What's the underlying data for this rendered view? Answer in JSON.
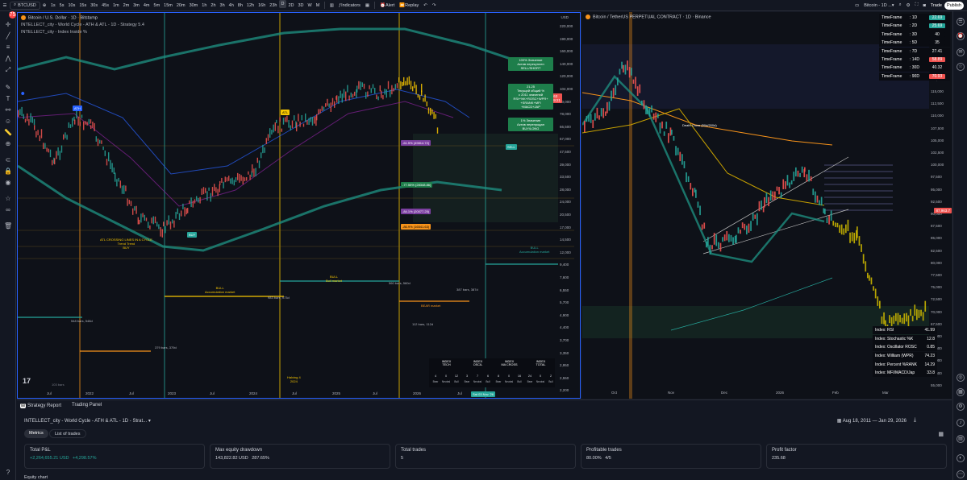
{
  "toolbar": {
    "symbol": "BTCUSD",
    "timeframes": [
      "1s",
      "5s",
      "10s",
      "15s",
      "30s",
      "45s",
      "1m",
      "2m",
      "3m",
      "4m",
      "5m",
      "15m",
      "20m",
      "30m",
      "1h",
      "2h",
      "3h",
      "4h",
      "8h",
      "12h",
      "16h",
      "23h",
      "D",
      "2D",
      "3D",
      "W",
      "M"
    ],
    "selected_timeframe": "D",
    "indicators_label": "Indicators",
    "alert_label": "Alert",
    "replay_label": "Replay",
    "right_symbol": "Bitcoin - 1D ...",
    "trade_label": "Trade",
    "publish_label": "Publish",
    "notif_count": "75"
  },
  "left_pane": {
    "title": "Bitcoin / U.S. Dollar · 1D · Bitstamp",
    "legend1": "INTELLECT_city - World Cycle - ATH & ATL - 1D - Strategy 5.4",
    "legend2": "INTELLECT_city - Index Inside %",
    "currency": "USD",
    "price_axis": [
      "220,000",
      "190,000",
      "160,000",
      "140,000",
      "120,000",
      "104,000",
      "90,000",
      "78,000",
      "66,500",
      "57,000",
      "47,500",
      "39,000",
      "33,500",
      "28,000",
      "24,000",
      "20,500",
      "17,000",
      "14,500",
      "12,000",
      "9,400",
      "7,600",
      "6,550",
      "5,700",
      "4,900",
      "4,400",
      "3,700",
      "3,350",
      "2,950",
      "2,550",
      "2,200"
    ],
    "time_axis": [
      "Jul",
      "2022",
      "Jul",
      "2023",
      "Jul",
      "2024",
      "Jul",
      "2025",
      "Jul",
      "2026",
      "Jul"
    ],
    "current_price": "87,963",
    "current_price_sub": "15:09:21",
    "label_ath": "ATH",
    "label_atl": "ATL",
    "label_bull_acc": "BULL\nAccumulation market",
    "label_bull_mkt": "BULL\nBull market",
    "label_bear_mkt": "BEAR market",
    "label_halving": "Halving 4\n2024",
    "label_bull_acc2": "BULL\nAccumulation market",
    "label_sell_box": "100% Значение\nАктив перекуплен\nSELL/SHORT",
    "label_middle_box": "21.25\nТекущий общий %\nс 2011 значений\nRSI+%K+ROSC+WPR+\n+SRANK+MFI\n+MACD+JAP",
    "label_buy_box": "1% Значение\nАктив перепродан\nBUY/LONG",
    "pct1": "-61.5% (49814.72)",
    "pct2": "-77.55% (28348.86)",
    "pct3": "-84.1% (20077.25)",
    "pct4": "-86.9% (16541.63)",
    "bars1": "103 bars",
    "bars2": "548 bars, 548d",
    "bars3": "379 bars, 379d",
    "bars4": "983 bars, 973d",
    "bars5": "560 bars, 560d",
    "bars6": "387 bars, 387d",
    "bars7": "112 bars, 112d",
    "date_tag": "Sat 03 Nov '26",
    "atl_crossing": "ATL CROSSING LINES IN A CYCLE\nTrend Trend\nBUY",
    "index_tech": "INDEX\nTECH",
    "index_osc": "INDEX\nOSCIL",
    "index_macross": "INDEX\nMA CROSS",
    "index_total": "INDEX\nTOTAL",
    "index_cols": [
      "Bear",
      "Neutral",
      "Bull",
      "Bear",
      "Neutral",
      "Bull",
      "Bear",
      "Neutral",
      "Bull",
      "Bear",
      "Neutral",
      "Bull"
    ],
    "index_vals": [
      "4",
      "0",
      "12",
      "3",
      "7",
      "6",
      "8",
      "0",
      "16",
      "24",
      "0",
      "2"
    ]
  },
  "right_pane": {
    "title": "Bitcoin / TetherUS PERPETUAL CONTRACT · 1D · Binance",
    "currency": "USDT",
    "price_axis": [
      "127,500",
      "125,000",
      "122,500",
      "120,000",
      "117,500",
      "115,000",
      "112,500",
      "110,000",
      "107,500",
      "105,000",
      "102,500",
      "100,000",
      "97,500",
      "95,000",
      "92,500",
      "90,000",
      "87,500",
      "85,000",
      "82,500",
      "80,000",
      "77,500",
      "75,000",
      "72,500",
      "70,000",
      "67,500",
      "65,000",
      "62,500",
      "60,000",
      "57,500",
      "55,000"
    ],
    "time_axis": [
      "Oct",
      "Nov",
      "Dec",
      "2026",
      "Feb",
      "Mar"
    ],
    "current_price": "87,963.7",
    "death_cross": "Death Cross (50d/200d)",
    "timeframe_table": [
      {
        "label": "TimeFrame",
        "tf": ": 1D",
        "val": "22.69",
        "color": "#26a69a"
      },
      {
        "label": "TimeFrame",
        "tf": ": 2D",
        "val": "25.69",
        "color": "#26a69a"
      },
      {
        "label": "TimeFrame",
        "tf": ": 3D",
        "val": "40",
        "color": "#0a0c12"
      },
      {
        "label": "TimeFrame",
        "tf": ": 5D",
        "val": "35",
        "color": "#0a0c12"
      },
      {
        "label": "TimeFrame",
        "tf": ": 7D",
        "val": "27.41",
        "color": "#0a0c12"
      },
      {
        "label": "TimeFrame",
        "tf": ": 14D",
        "val": "58.89",
        "color": "#ef5350"
      },
      {
        "label": "TimeFrame",
        "tf": ": 30D",
        "val": "40.32",
        "color": "#0a0c12"
      },
      {
        "label": "TimeFrame",
        "tf": ": 90D",
        "val": "70.93",
        "color": "#ef5350"
      }
    ],
    "index_table": [
      {
        "label": "Index: RSI",
        "val": "41.99"
      },
      {
        "label": "Index: Stochastic %K",
        "val": "12.8"
      },
      {
        "label": "Index: Oscillator ROSC",
        "val": "0.85"
      },
      {
        "label": "Index: William (WPR)",
        "val": "74.23"
      },
      {
        "label": "Index: Percent %RANK",
        "val": "14.29"
      },
      {
        "label": "Index: MFI/MACD/Jap",
        "val": "33.8"
      }
    ]
  },
  "bottom": {
    "tab1": "Strategy Report",
    "tab2": "Trading Panel",
    "strategy_name": "INTELLECT_city - World Cycle - ATH & ATL - 1D - Strat...",
    "date_range": "Aug 18, 2011 — Jan 29, 2026",
    "pill_metrics": "Metrics",
    "pill_trades": "List of trades",
    "metrics": [
      {
        "label": "Total P&L",
        "val": "+2,264,655.21 USD",
        "val2": "+4,298.57%",
        "color": "#26a69a"
      },
      {
        "label": "Max equity drawdown",
        "val": "143,822.82 USD",
        "val2": "287.65%",
        "color": "#d1d4dc"
      },
      {
        "label": "Total trades",
        "val": "5",
        "val2": "",
        "color": "#d1d4dc"
      },
      {
        "label": "Profitable trades",
        "val": "80.00%",
        "val2": "4/5",
        "color": "#d1d4dc"
      },
      {
        "label": "Profit factor",
        "val": "235.68",
        "val2": "",
        "color": "#d1d4dc"
      }
    ]
  }
}
